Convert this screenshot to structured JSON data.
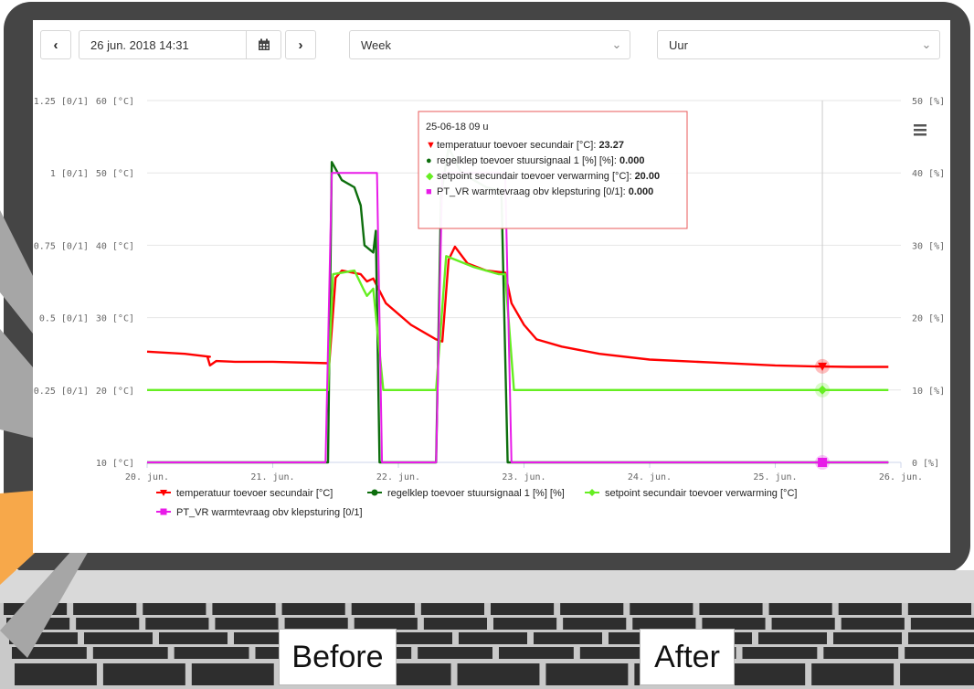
{
  "toolbar": {
    "prev_label": "‹",
    "next_label": "›",
    "date_value": "26 jun. 2018 14:31",
    "period_value": "Week",
    "interval_value": "Uur",
    "icons": [
      "calendar-icon",
      "chevron-down-icon",
      "menu-icon"
    ]
  },
  "colors": {
    "temperature": "#ff0000",
    "valve": "#0d6e0d",
    "setpoint": "#66ee22",
    "demand": "#e81be8",
    "accent": "#f7a84a",
    "tooltip_border": "#e85a5a"
  },
  "captions": {
    "before": "Before",
    "after": "After"
  },
  "chart_data": {
    "type": "line",
    "x_axis": {
      "type": "date",
      "range": [
        "2018-06-20 00:00",
        "2018-06-26 00:00"
      ],
      "tick_labels": [
        "20. jun.",
        "21. jun.",
        "22. jun.",
        "23. jun.",
        "24. jun.",
        "25. jun.",
        "26. jun."
      ]
    },
    "y_axes": [
      {
        "id": "ratio",
        "unit": "[0/1]",
        "range": [
          0,
          1.25
        ],
        "tick_values": [
          0.25,
          0.5,
          0.75,
          1,
          1.25
        ],
        "tick_labels": [
          "0.25 [0/1]",
          "0.5 [0/1]",
          "0.75 [0/1]",
          "1 [0/1]",
          "1.25 [0/1]"
        ]
      },
      {
        "id": "temp",
        "unit": "[°C]",
        "range": [
          10,
          60
        ],
        "tick_values": [
          10,
          20,
          30,
          40,
          50,
          60
        ],
        "tick_labels": [
          "10 [°C]",
          "20 [°C]",
          "30 [°C]",
          "40 [°C]",
          "50 [°C]",
          "60 [°C]"
        ]
      },
      {
        "id": "percent",
        "unit": "[%]",
        "range": [
          0,
          50
        ],
        "tick_values": [
          0,
          10,
          20,
          30,
          40,
          50
        ],
        "tick_labels": [
          "0 [%]",
          "10 [%]",
          "20 [%]",
          "30 [%]",
          "40 [%]",
          "50 [%]"
        ]
      }
    ],
    "grid": true,
    "legend_placement": "bottom-left",
    "series": [
      {
        "name": "temperatuur toevoer secundair [°C]",
        "axis": "temp",
        "color": "#ff0000",
        "marker": "triangle-down",
        "points": [
          [
            0.0,
            25.3
          ],
          [
            0.3,
            25.0
          ],
          [
            0.5,
            24.6
          ],
          [
            0.48,
            24.6
          ],
          [
            0.5,
            23.4
          ],
          [
            0.55,
            24.0
          ],
          [
            0.7,
            23.9
          ],
          [
            1.0,
            23.9
          ],
          [
            1.45,
            23.7
          ],
          [
            1.5,
            35.5
          ],
          [
            1.55,
            36.5
          ],
          [
            1.7,
            36.0
          ],
          [
            1.75,
            35.0
          ],
          [
            1.8,
            35.4
          ],
          [
            1.9,
            32.0
          ],
          [
            2.1,
            29.0
          ],
          [
            2.3,
            27.0
          ],
          [
            2.35,
            26.7
          ],
          [
            2.4,
            38.0
          ],
          [
            2.45,
            39.8
          ],
          [
            2.55,
            37.5
          ],
          [
            2.7,
            36.5
          ],
          [
            2.85,
            36.2
          ],
          [
            2.9,
            32.0
          ],
          [
            3.0,
            29.0
          ],
          [
            3.1,
            27.0
          ],
          [
            3.3,
            26.0
          ],
          [
            3.6,
            25.0
          ],
          [
            4.0,
            24.2
          ],
          [
            4.5,
            23.8
          ],
          [
            5.0,
            23.4
          ],
          [
            5.3,
            23.27
          ],
          [
            5.6,
            23.2
          ],
          [
            5.9,
            23.2
          ]
        ]
      },
      {
        "name": "regelklep toevoer stuursignaal 1 [%] [%]",
        "axis": "percent",
        "color": "#0d6e0d",
        "marker": "circle",
        "points": [
          [
            0.0,
            0
          ],
          [
            1.44,
            0
          ],
          [
            1.47,
            41.5
          ],
          [
            1.55,
            39.0
          ],
          [
            1.65,
            38.0
          ],
          [
            1.7,
            35.5
          ],
          [
            1.73,
            30.0
          ],
          [
            1.8,
            29.0
          ],
          [
            1.82,
            32.0
          ],
          [
            1.85,
            0
          ],
          [
            2.3,
            0
          ],
          [
            2.34,
            37.0
          ],
          [
            2.4,
            43.5
          ],
          [
            2.5,
            40.0
          ],
          [
            2.7,
            38.0
          ],
          [
            2.82,
            37.5
          ],
          [
            2.87,
            0
          ],
          [
            5.9,
            0
          ]
        ]
      },
      {
        "name": "setpoint secundair toevoer verwarming [°C]",
        "axis": "temp",
        "color": "#66ee22",
        "marker": "diamond",
        "points": [
          [
            0.0,
            20.0
          ],
          [
            1.44,
            20.0
          ],
          [
            1.48,
            36.0
          ],
          [
            1.65,
            36.5
          ],
          [
            1.72,
            34.0
          ],
          [
            1.75,
            33.0
          ],
          [
            1.8,
            34.0
          ],
          [
            1.88,
            20.0
          ],
          [
            2.3,
            20.0
          ],
          [
            2.38,
            38.5
          ],
          [
            2.6,
            37.0
          ],
          [
            2.8,
            36.0
          ],
          [
            2.85,
            36.0
          ],
          [
            2.92,
            20.0
          ],
          [
            5.9,
            20.0
          ]
        ]
      },
      {
        "name": "PT_VR warmtevraag obv klepsturing [0/1]",
        "axis": "ratio",
        "color": "#e81be8",
        "marker": "square",
        "points": [
          [
            0.0,
            0
          ],
          [
            1.42,
            0
          ],
          [
            1.47,
            1.0
          ],
          [
            1.83,
            1.0
          ],
          [
            1.87,
            0
          ],
          [
            2.3,
            0
          ],
          [
            2.35,
            1.0
          ],
          [
            2.85,
            1.0
          ],
          [
            2.9,
            0
          ],
          [
            5.9,
            0
          ]
        ]
      }
    ],
    "crosshair": {
      "x_day": 5.375,
      "label": "25-06-18 09 u"
    },
    "tooltip": {
      "title": "25-06-18 09 u",
      "rows": [
        {
          "label": "temperatuur toevoer secundair [°C]:",
          "value": "23.27",
          "marker": "▼",
          "color": "#ff0000"
        },
        {
          "label": "regelklep toevoer stuursignaal 1 [%] [%]:",
          "value": "0.000",
          "marker": "●",
          "color": "#0d6e0d"
        },
        {
          "label": "setpoint secundair toevoer verwarming [°C]:",
          "value": "20.00",
          "marker": "◆",
          "color": "#66ee22"
        },
        {
          "label": "PT_VR warmtevraag obv klepsturing [0/1]:",
          "value": "0.000",
          "marker": "■",
          "color": "#e81be8"
        }
      ]
    },
    "legend": [
      {
        "label": "temperatuur toevoer secundair [°C]",
        "color": "#ff0000",
        "marker": "triangle-down"
      },
      {
        "label": "regelklep toevoer stuursignaal 1 [%] [%]",
        "color": "#0d6e0d",
        "marker": "circle"
      },
      {
        "label": "setpoint secundair toevoer verwarming [°C]",
        "color": "#66ee22",
        "marker": "diamond"
      },
      {
        "label": "PT_VR warmtevraag obv klepsturing [0/1]",
        "color": "#e81be8",
        "marker": "square"
      }
    ]
  }
}
